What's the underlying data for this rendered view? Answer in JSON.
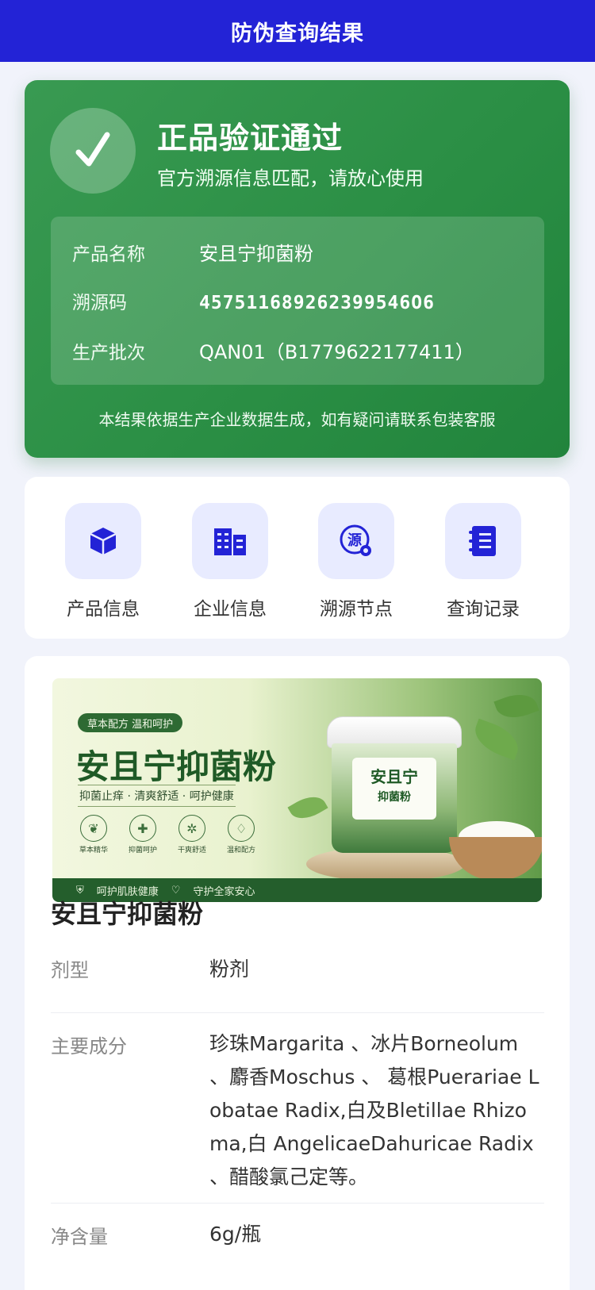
{
  "header": {
    "title": "防伪查询结果"
  },
  "verify": {
    "title": "正品验证通过",
    "subtitle": "官方溯源信息匹配，请放心使用",
    "check_icon": "check-icon",
    "rows": [
      {
        "label": "产品名称",
        "value": "安且宁抑菌粉"
      },
      {
        "label": "溯源码",
        "value": "457511689262399546O6"
      },
      {
        "label": "生产批次",
        "value": "QAN01（B1779622177411）"
      }
    ],
    "note": "本结果依据生产企业数据生成，如有疑问请联系包装客服",
    "colors": {
      "card": "#2b8f45",
      "accent": "#2323d6"
    }
  },
  "nav": {
    "items": [
      {
        "label": "产品信息",
        "icon": "cube-icon"
      },
      {
        "label": "企业信息",
        "icon": "building-icon"
      },
      {
        "label": "溯源节点",
        "icon": "source-icon",
        "icon_glyph": "源"
      },
      {
        "label": "查询记录",
        "icon": "record-book-icon"
      }
    ]
  },
  "banner": {
    "tag": "草本配方 温和呵护",
    "title": "安且宁抑菌粉",
    "slogan": "抑菌止痒 · 清爽舒适 · 呵护健康",
    "badges": [
      {
        "text": "草本精华",
        "glyph": "❦"
      },
      {
        "text": "抑菌呵护",
        "glyph": "✚"
      },
      {
        "text": "干爽舒适",
        "glyph": "✲"
      },
      {
        "text": "温和配方",
        "glyph": "♢"
      }
    ],
    "jar_brand": "安且宁",
    "jar_product": "抑菌粉",
    "bottom_left": "呵护肌肤健康",
    "bottom_right": "守护全家安心"
  },
  "product": {
    "name": "安且宁抑菌粉",
    "specs": [
      {
        "label": "剂型",
        "value": "粉剂"
      },
      {
        "label": "主要成分",
        "value": "珍珠Margarita 、冰片Borneolum 、麝香Moschus 、 葛根Puerariae Lobatae Radix,白及Bletillae Rhizoma,白 AngelicaeDahuricae Radix 、醋酸氯己定等。"
      },
      {
        "label": "净含量",
        "value": "6g/瓶"
      }
    ]
  }
}
